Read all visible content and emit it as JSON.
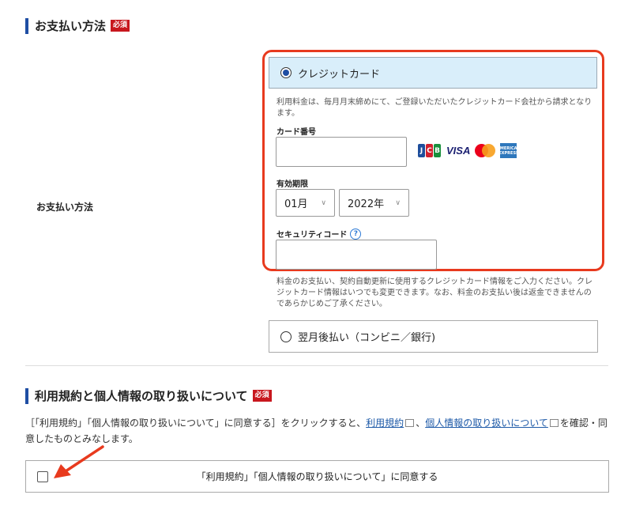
{
  "payment": {
    "section_title": "お支払い方法",
    "required_badge": "必須",
    "row_label": "お支払い方法",
    "credit_card": {
      "label": "クレジットカード",
      "selected": true,
      "note": "利用料金は、毎月月末締めにて、ご登録いただいたクレジットカード会社から請求となります。",
      "card_number_label": "カード番号",
      "card_number_value": "",
      "brands": [
        "JCB",
        "VISA",
        "Mastercard",
        "AMERICAN EXPRESS"
      ],
      "expiry_label": "有効期限",
      "expiry_month": "01月",
      "expiry_year": "2022年",
      "security_code_label": "セキュリティコード",
      "security_code_value": "",
      "help_glyph": "?"
    },
    "cc_notice": "料金のお支払い、契約自動更新に使用するクレジットカード情報をご入力ください。クレジットカード情報はいつでも変更できます。なお、料金のお支払い後は返金できませんのであらかじめご了承ください。",
    "deferred": {
      "label": "翌月後払い（コンビニ／銀行)",
      "selected": false
    }
  },
  "terms": {
    "section_title": "利用規約と個人情報の取り扱いについて",
    "required_badge": "必須",
    "consent_before": "［「利用規約」「個人情報の取り扱いについて」に同意する］をクリックすると、",
    "link_terms": "利用規約",
    "separator": "、",
    "link_privacy": "個人情報の取り扱いについて",
    "consent_after": "を確認・同意したものとみなします。",
    "agree_label": "「利用規約」「個人情報の取り扱いについて」に同意する",
    "agree_checked": false
  },
  "colors": {
    "accent_bar": "#1f4ea3",
    "required_badge": "#c8171e",
    "highlight_frame": "#e83a1e",
    "selected_option_bg": "#d9eefa",
    "annotation_arrow": "#e83a1e"
  }
}
